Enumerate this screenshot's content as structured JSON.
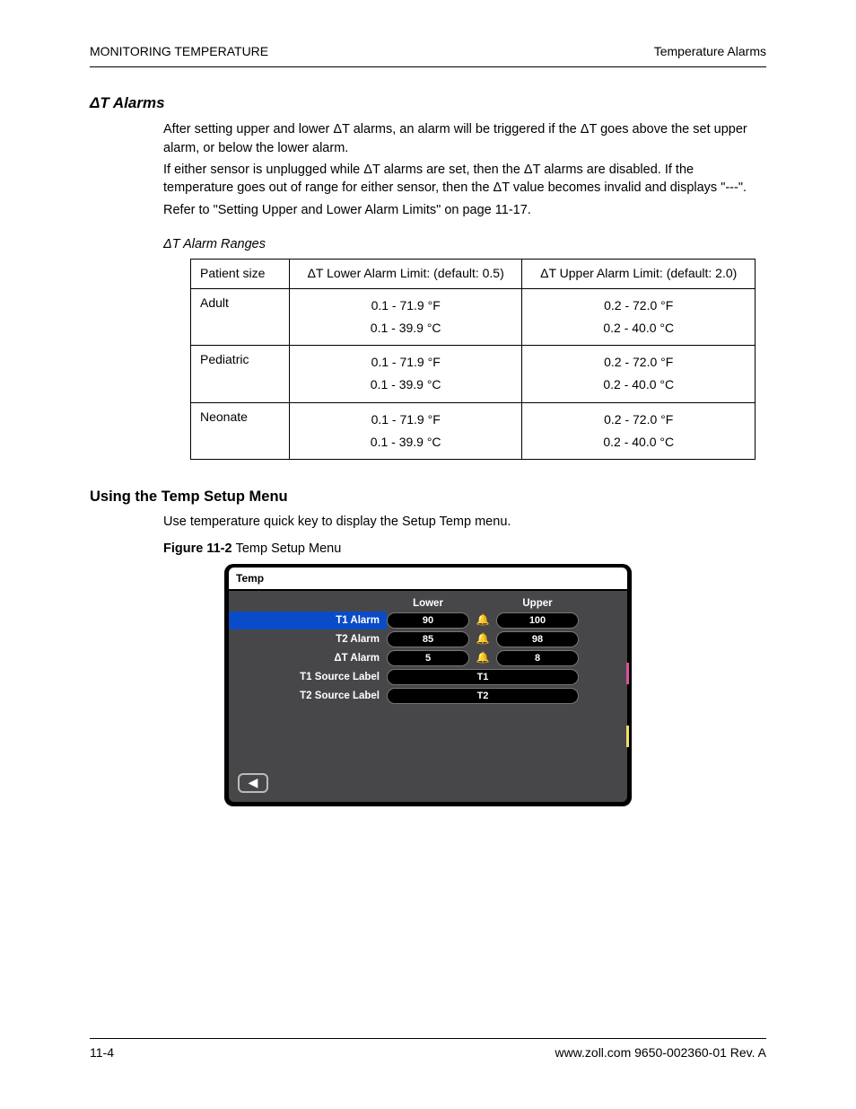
{
  "header": {
    "left": "MONITORING TEMPERATURE",
    "right": "Temperature Alarms"
  },
  "sections": {
    "dt_alarms": {
      "title": "ΔT Alarms",
      "p1": "After setting upper and lower ΔT alarms, an alarm will be triggered if the ΔT goes above the set upper alarm, or below the lower alarm.",
      "p2": "If either sensor is unplugged while ΔT alarms are set, then the ΔT alarms are disabled. If the temperature goes out of range for either sensor, then the ΔT value becomes invalid and displays \"---\".",
      "p3": "Refer to \"Setting Upper and Lower Alarm Limits\" on page 11-17."
    },
    "ranges": {
      "title": "ΔT Alarm Ranges",
      "headers": [
        "Patient size",
        "ΔT Lower Alarm Limit: (default: 0.5)",
        "ΔT Upper Alarm Limit: (default: 2.0)"
      ],
      "rows": [
        {
          "label": "Adult",
          "lower": [
            "0.1 - 71.9 °F",
            "0.1 - 39.9 °C"
          ],
          "upper": [
            "0.2 - 72.0 °F",
            "0.2 - 40.0 °C"
          ]
        },
        {
          "label": "Pediatric",
          "lower": [
            "0.1 - 71.9 °F",
            "0.1 - 39.9 °C"
          ],
          "upper": [
            "0.2 - 72.0 °F",
            "0.2 - 40.0 °C"
          ]
        },
        {
          "label": "Neonate",
          "lower": [
            "0.1 - 71.9 °F",
            "0.1 - 39.9 °C"
          ],
          "upper": [
            "0.2 - 72.0 °F",
            "0.2 - 40.0 °C"
          ]
        }
      ]
    },
    "setup": {
      "title": "Using the Temp Setup Menu",
      "p1": "Use temperature quick key to display the Setup Temp menu."
    },
    "figure": {
      "label": "Figure 11-2",
      "caption": "Temp Setup Menu"
    }
  },
  "ui": {
    "tab": "Temp",
    "cols": [
      "Lower",
      "Upper"
    ],
    "rows": [
      {
        "label": "T1 Alarm",
        "lower": "90",
        "upper": "100"
      },
      {
        "label": "T2 Alarm",
        "lower": "85",
        "upper": "98"
      },
      {
        "label": "ΔT Alarm",
        "lower": "5",
        "upper": "8"
      },
      {
        "label": "T1 Source Label",
        "value": "T1"
      },
      {
        "label": "T2 Source Label",
        "value": "T2"
      }
    ]
  },
  "footer": {
    "left": "11-4",
    "right": "www.zoll.com      9650-002360-01 Rev. A"
  }
}
